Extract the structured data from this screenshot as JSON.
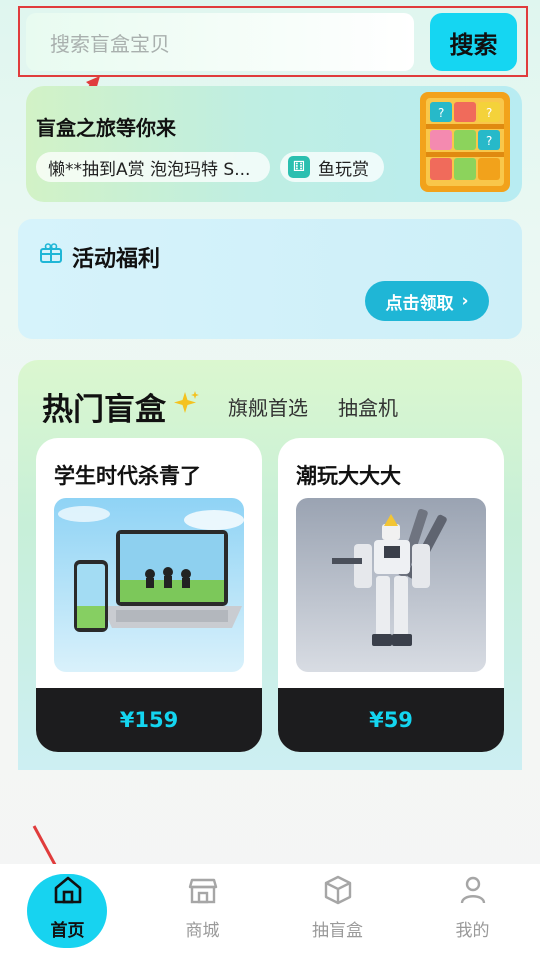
{
  "search": {
    "placeholder": "搜索盲盒宝贝",
    "button_label": "搜索"
  },
  "banner": {
    "title": "盲盒之旅等你来",
    "ticker_text": "懒**抽到A赏 泡泡玛特 S...",
    "tag_label": "鱼玩赏"
  },
  "activity": {
    "title": "活动福利",
    "claim_label": "点击领取"
  },
  "hot": {
    "title": "热门盲盒",
    "tabs": [
      "旗舰首选",
      "抽盒机"
    ],
    "cards": [
      {
        "title": "学生时代杀青了",
        "price": "¥159",
        "image_icon": "laptop-phone-graduation-image"
      },
      {
        "title": "潮玩大大大",
        "price": "¥59",
        "image_icon": "mecha-robot-figure-image"
      }
    ]
  },
  "nav": {
    "items": [
      {
        "label": "首页",
        "icon": "home-icon"
      },
      {
        "label": "商城",
        "icon": "store-icon"
      },
      {
        "label": "抽盲盒",
        "icon": "box-icon"
      },
      {
        "label": "我的",
        "icon": "user-icon"
      }
    ]
  },
  "colors": {
    "accent": "#15d6f2",
    "price": "#14d5f0",
    "annotation": "#e03c3c"
  }
}
